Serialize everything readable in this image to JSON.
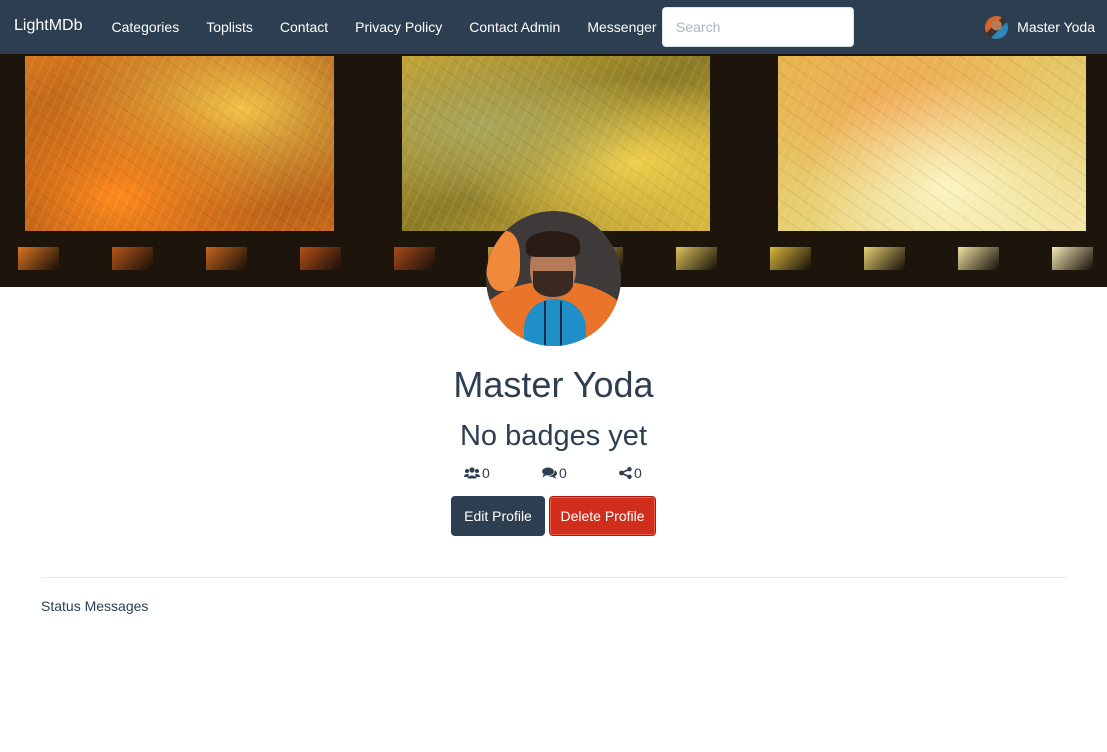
{
  "navbar": {
    "brand": "LightMDb",
    "links": [
      "Categories",
      "Toplists",
      "Contact",
      "Privacy Policy",
      "Contact Admin",
      "Messenger"
    ],
    "search_placeholder": "Search",
    "user_name": "Master Yoda"
  },
  "profile": {
    "name": "Master Yoda",
    "badges_text": "No badges yet",
    "stats": {
      "friends_count": "0",
      "comments_count": "0",
      "shares_count": "0"
    },
    "edit_label": "Edit Profile",
    "delete_label": "Delete Profile"
  },
  "sections": {
    "status_messages_title": "Status Messages"
  },
  "colors": {
    "navbar_bg": "#2c3e50",
    "primary": "#2c3e50",
    "danger": "#d02d1c"
  },
  "icons": {
    "friends": "users-icon",
    "comments": "comments-icon",
    "shares": "share-alt-icon"
  }
}
